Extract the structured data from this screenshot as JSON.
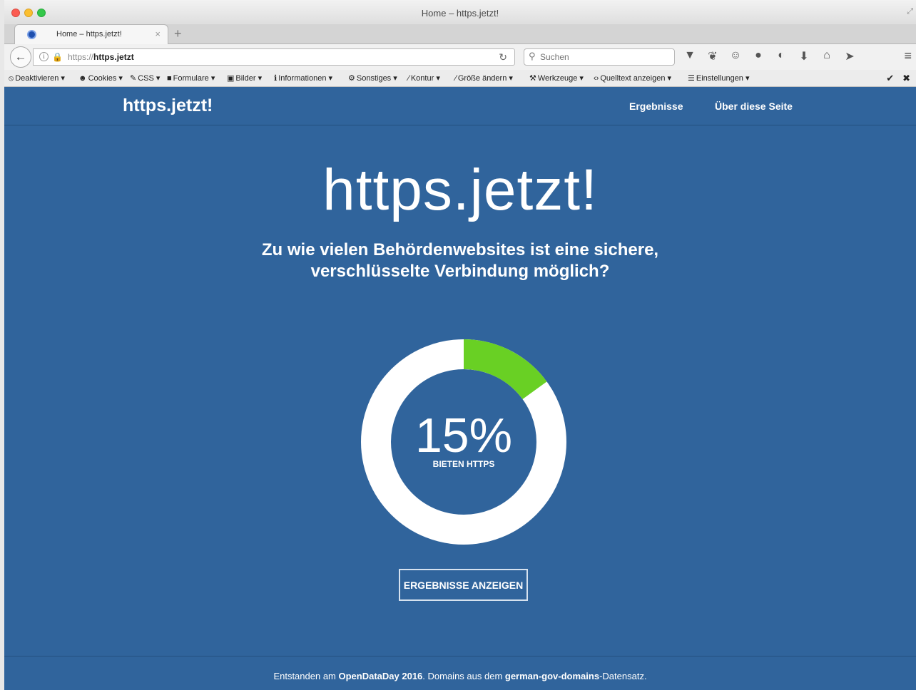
{
  "window": {
    "title": "Home – https.jetzt!"
  },
  "tab": {
    "title": "Home – https.jetzt!",
    "close": "×",
    "new_tab": "+"
  },
  "navbar": {
    "url_scheme": "https://",
    "url_host": "https.jetzt",
    "search_placeholder": "Suchen"
  },
  "devbar": {
    "items": [
      "Deaktivieren",
      "Cookies",
      "CSS",
      "Formulare",
      "Bilder",
      "Informationen",
      "Sonstiges",
      "Kontur",
      "Größe ändern",
      "Werkzeuge",
      "Quelltext anzeigen",
      "Einstellungen"
    ],
    "check": "✔",
    "close": "✖"
  },
  "site": {
    "brand": "https.jetzt!",
    "nav": {
      "results": "Ergebnisse",
      "about": "Über diese Seite"
    },
    "hero_title": "https.jetzt!",
    "hero_sub_line1": "Zu wie vielen Behördenwebsites ist eine sichere,",
    "hero_sub_line2": "verschlüsselte Verbindung möglich?",
    "percentage_text": "15%",
    "percentage_label": "BIETEN HTTPS",
    "button_label": "ERGEBNISSE ANZEIGEN",
    "footer": {
      "prefix": "Entstanden am ",
      "event": "OpenDataDay 2016",
      "middle": ". Domains aus dem ",
      "dataset": "german-gov-domains",
      "suffix": "-Datensatz."
    }
  },
  "gauge": {
    "value_fraction": 0.15,
    "fill_color": "#69d024",
    "track_color": "#ffffff"
  },
  "colors": {
    "page_background": "#30649c",
    "accent_green": "#69d024"
  }
}
